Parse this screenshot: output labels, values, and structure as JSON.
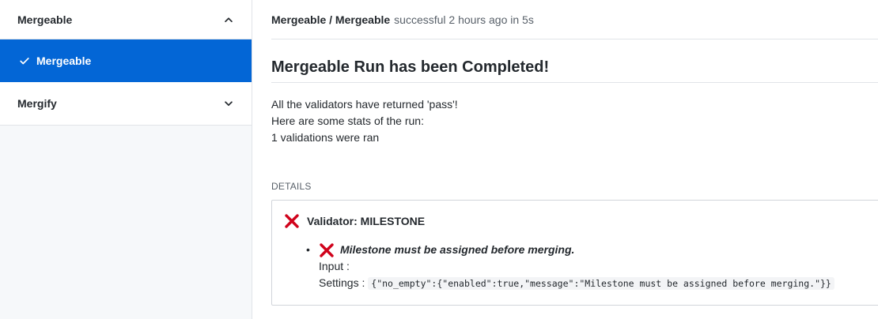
{
  "sidebar": {
    "sections": [
      {
        "label": "Mergeable",
        "expanded": true,
        "icon": "chevron-up-icon"
      },
      {
        "label": "Mergeable",
        "active": true,
        "icon": "check-icon"
      },
      {
        "label": "Mergify",
        "expanded": false,
        "icon": "chevron-down-icon"
      }
    ]
  },
  "header": {
    "path": "Mergeable / Mergeable",
    "status": "successful 2 hours ago in 5s"
  },
  "main": {
    "title": "Mergeable Run has been Completed!",
    "summary": [
      "All the validators have returned 'pass'!",
      "Here are some stats of the run:",
      "1 validations were ran"
    ],
    "details_label": "DETAILS",
    "validator": {
      "name": "Validator: MILESTONE",
      "status_icon": "x-icon",
      "message": "Milestone must be assigned before merging.",
      "input_label": "Input :",
      "settings_label": "Settings :",
      "settings_value": "{\"no_empty\":{\"enabled\":true,\"message\":\"Milestone must be assigned before merging.\"}}"
    }
  },
  "colors": {
    "accent": "#0366d6",
    "error": "#d73a49"
  }
}
